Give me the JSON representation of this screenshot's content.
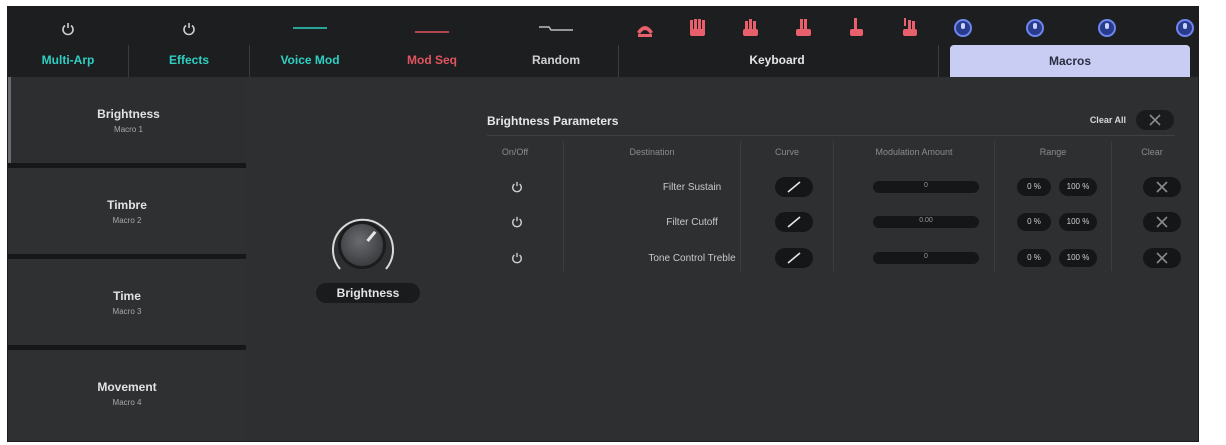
{
  "colors": {
    "multi_arp": "#2fd0c2",
    "effects": "#2fd0c2",
    "voice_mod": "#2fd0c2",
    "mod_seq": "#e0555f",
    "random": "#cfcfcf",
    "keyboard_icons": "#e8606b",
    "macro_accent": "#6f86f0",
    "macros_tab_bg": "#c9cdf4"
  },
  "tabs": [
    {
      "label": "Multi-Arp",
      "icon": "power-icon"
    },
    {
      "label": "Effects",
      "icon": "power-icon"
    },
    {
      "label": "Voice Mod",
      "icon": "line-icon"
    },
    {
      "label": "Mod Seq",
      "icon": "line-icon"
    },
    {
      "label": "Random",
      "icon": "random-line-icon"
    },
    {
      "label": "Keyboard",
      "icon": "hand-icons"
    },
    {
      "label": "Macros",
      "icon": "macro-knob-icons"
    }
  ],
  "macro_list": [
    {
      "title": "Brightness",
      "subtitle": "Macro 1"
    },
    {
      "title": "Timbre",
      "subtitle": "Macro 2"
    },
    {
      "title": "Time",
      "subtitle": "Macro 3"
    },
    {
      "title": "Movement",
      "subtitle": "Macro 4"
    }
  ],
  "knob": {
    "label": "Brightness"
  },
  "params": {
    "title": "Brightness Parameters",
    "clear_all": "Clear All",
    "headers": [
      "On/Off",
      "Destination",
      "Curve",
      "Modulation Amount",
      "Range",
      "Clear"
    ],
    "rows": [
      {
        "destination": "Filter Sustain",
        "mod_value": "0",
        "range_min": "0 %",
        "range_max": "100 %"
      },
      {
        "destination": "Filter Cutoff",
        "mod_value": "0.00",
        "range_min": "0 %",
        "range_max": "100 %"
      },
      {
        "destination": "Tone Control Treble",
        "mod_value": "0",
        "range_min": "0 %",
        "range_max": "100 %"
      }
    ]
  }
}
